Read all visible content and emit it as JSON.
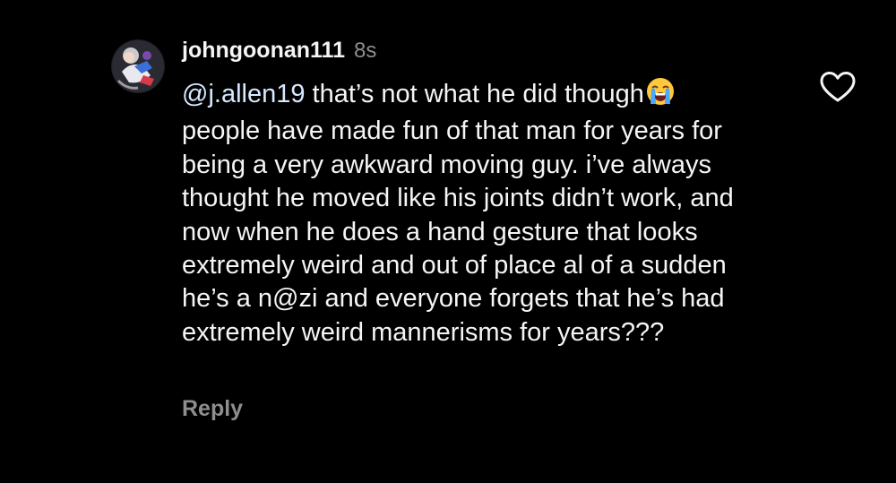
{
  "comment": {
    "username": "johngoonan111",
    "timestamp": "8s",
    "mention": "@j.allen19",
    "text_after_mention": " that’s not what he did though",
    "emoji": "loudly-crying-face-emoji",
    "text_rest": "people have made fun of that man for years for being a very awkward moving guy. i’ve always thought he moved like his joints didn’t work, and now when he does a hand gesture that looks extremely weird and out of place al of a sudden he’s a n@zi and everyone forgets that he’s had extremely weird mannerisms for years???",
    "reply_label": "Reply",
    "like_icon": "heart-outline-icon"
  },
  "colors": {
    "background": "#000000",
    "text": "#f5f5f5",
    "secondary": "#8e8e8e",
    "mention": "#d6e9ff"
  }
}
